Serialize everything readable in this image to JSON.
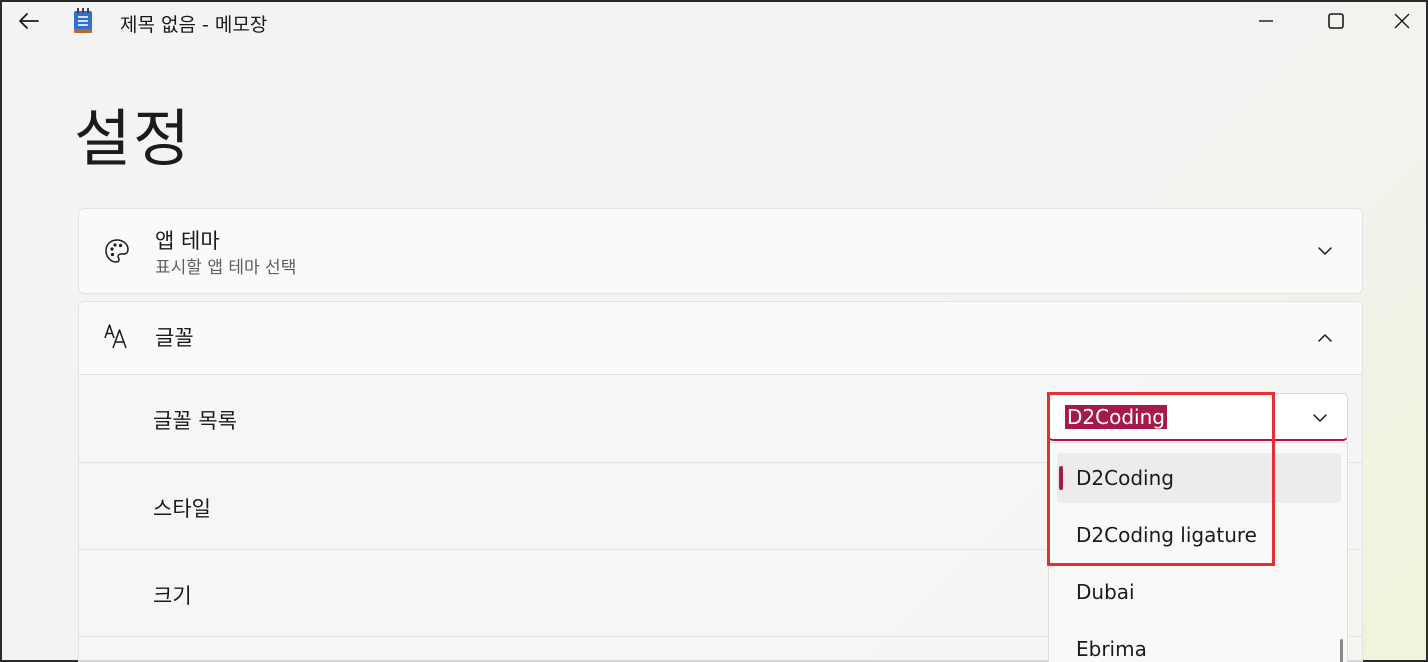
{
  "window": {
    "title": "제목 없음 - 메모장"
  },
  "page": {
    "title": "설정"
  },
  "theme_card": {
    "title": "앱 테마",
    "subtitle": "표시할 앱 테마 선택",
    "icon": "palette-icon"
  },
  "font_card": {
    "title": "글꼴",
    "icon": "font-icon",
    "rows": [
      {
        "label": "글꼴 목록"
      },
      {
        "label": "스타일"
      },
      {
        "label": "크기"
      }
    ]
  },
  "font_combo": {
    "value": "D2Coding",
    "options": [
      "D2Coding",
      "D2Coding ligature",
      "Dubai",
      "Ebrima"
    ],
    "selected_index": 0
  },
  "colors": {
    "accent": "#a6194b",
    "highlight_box": "#e53030"
  }
}
